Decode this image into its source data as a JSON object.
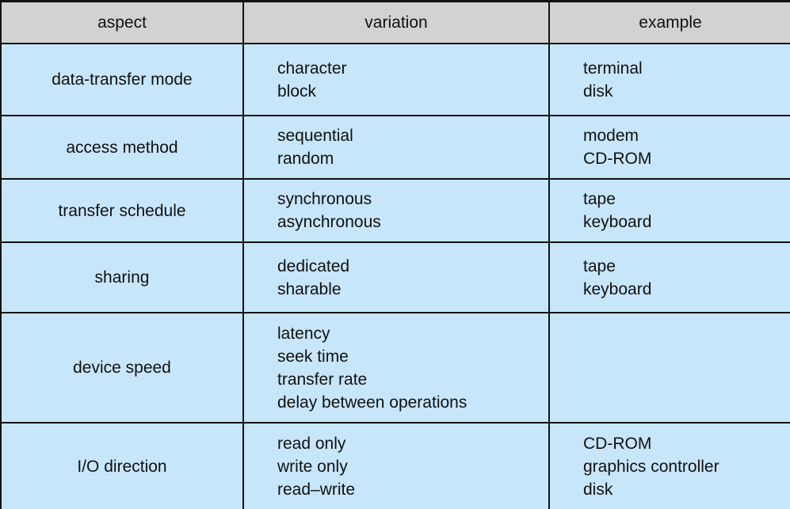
{
  "table": {
    "headers": [
      "aspect",
      "variation",
      "example"
    ],
    "rows": [
      {
        "aspect": "data-transfer mode",
        "variation": [
          "character",
          "block"
        ],
        "example": [
          "terminal",
          "disk"
        ]
      },
      {
        "aspect": "access method",
        "variation": [
          "sequential",
          "random"
        ],
        "example": [
          "modem",
          "CD-ROM"
        ]
      },
      {
        "aspect": "transfer schedule",
        "variation": [
          "synchronous",
          "asynchronous"
        ],
        "example": [
          "tape",
          "keyboard"
        ]
      },
      {
        "aspect": "sharing",
        "variation": [
          "dedicated",
          "sharable"
        ],
        "example": [
          "tape",
          "keyboard"
        ]
      },
      {
        "aspect": "device speed",
        "variation": [
          "latency",
          "seek time",
          "transfer rate",
          "delay between operations"
        ],
        "example": []
      },
      {
        "aspect": "I/O direction",
        "variation": [
          "read only",
          "write only",
          "read–write"
        ],
        "example": [
          "CD-ROM",
          "graphics controller",
          "disk"
        ]
      }
    ]
  },
  "colors": {
    "header_background": "#d2d2d2",
    "body_background": "#c7e6fa",
    "border": "#111111",
    "text": "#111111"
  }
}
